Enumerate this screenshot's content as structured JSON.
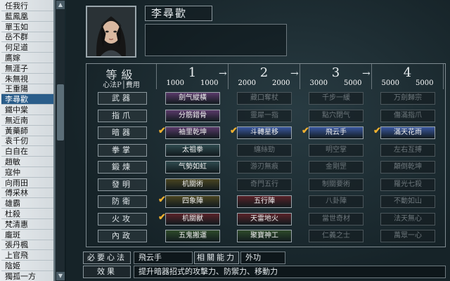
{
  "sidebar": {
    "items": [
      "任我行",
      "藍鳳凰",
      "單玉如",
      "岳不群",
      "何足道",
      "鷹嫁",
      "無涯子",
      "朱無視",
      "王重陽",
      "李尋歡",
      "鐵中棠",
      "無近南",
      "黃藥師",
      "袁千仞",
      "白自在",
      "趙敏",
      "寇仲",
      "向雨田",
      "傅采林",
      "雄霸",
      "杜殺",
      "梵清惠",
      "龐斑",
      "張丹楓",
      "上官飛",
      "陰姬",
      "獨孤一方"
    ],
    "active_index": 9
  },
  "character": {
    "name": "李尋歡"
  },
  "levels": {
    "header_title": "等級",
    "header_sub": "心法P│費用",
    "items": [
      {
        "num": "1",
        "cost_a": "1000",
        "cost_b": "1000"
      },
      {
        "num": "2",
        "cost_a": "2000",
        "cost_b": "2000"
      },
      {
        "num": "3",
        "cost_a": "3000",
        "cost_b": "5000"
      },
      {
        "num": "4",
        "cost_a": "5000",
        "cost_b": "5000"
      }
    ]
  },
  "rows": [
    {
      "label": "武器",
      "cells": [
        {
          "text": "劍气縱橫",
          "style": "purple"
        },
        {
          "text": "藏口奪杖",
          "style": "dim"
        },
        {
          "text": "千步一緩",
          "style": "dim"
        },
        {
          "text": "万劍歸宗",
          "style": "dim"
        }
      ]
    },
    {
      "label": "指爪",
      "cells": [
        {
          "text": "分筋錯骨",
          "style": "purple"
        },
        {
          "text": "靈犀一指",
          "style": "dim"
        },
        {
          "text": "點穴閉气",
          "style": "dim"
        },
        {
          "text": "傷滿指爪",
          "style": "dim"
        }
      ]
    },
    {
      "label": "暗器",
      "cells": [
        {
          "text": "袖里乾坤",
          "style": "purple",
          "check": true
        },
        {
          "text": "斗轉星移",
          "style": "blue",
          "check": true
        },
        {
          "text": "飛云手",
          "style": "blue",
          "check": true
        },
        {
          "text": "滿天花雨",
          "style": "blue",
          "check": true
        }
      ]
    },
    {
      "label": "拳掌",
      "cells": [
        {
          "text": "太祖拳",
          "style": "teal"
        },
        {
          "text": "纏絲勁",
          "style": "dim"
        },
        {
          "text": "明空掌",
          "style": "dim"
        },
        {
          "text": "左右互搏",
          "style": "dim"
        }
      ]
    },
    {
      "label": "鍛煉",
      "cells": [
        {
          "text": "气勢如虹",
          "style": "teal"
        },
        {
          "text": "游刃無痕",
          "style": "dim"
        },
        {
          "text": "金剛罡",
          "style": "dim"
        },
        {
          "text": "顛倒乾坤",
          "style": "dim"
        }
      ]
    },
    {
      "label": "發明",
      "cells": [
        {
          "text": "机關術",
          "style": "olive"
        },
        {
          "text": "奇門五行",
          "style": "dim"
        },
        {
          "text": "制關要術",
          "style": "dim"
        },
        {
          "text": "羅光七殺",
          "style": "dim"
        }
      ]
    },
    {
      "label": "防衛",
      "cells": [
        {
          "text": "四象陣",
          "style": "olive",
          "check": true
        },
        {
          "text": "五行陣",
          "style": "red"
        },
        {
          "text": "八卦陣",
          "style": "dim"
        },
        {
          "text": "不動如山",
          "style": "dim"
        }
      ]
    },
    {
      "label": "火攻",
      "cells": [
        {
          "text": "机關獸",
          "style": "red",
          "check": true
        },
        {
          "text": "天雷地火",
          "style": "red"
        },
        {
          "text": "當世奇材",
          "style": "dim"
        },
        {
          "text": "法天無心",
          "style": "dim"
        }
      ]
    },
    {
      "label": "內政",
      "cells": [
        {
          "text": "五鬼搬運",
          "style": "green"
        },
        {
          "text": "聚寶神工",
          "style": "green"
        },
        {
          "text": "仁義之士",
          "style": "dim"
        },
        {
          "text": "萬眾一心",
          "style": "dim"
        }
      ]
    }
  ],
  "bottom": {
    "req_label": "必要心法",
    "req_value": "飛云手",
    "rel_label": "相關能力",
    "rel_value": "外功",
    "effect_label": "效果",
    "effect_value": "提升暗器招式的攻擊力、防禦力、移動力"
  },
  "colors": {
    "purple": "#5a3a6a",
    "blue": "#3a58a0",
    "teal": "#2f4a4e",
    "olive": "#4a4520",
    "red": "#5a2228",
    "green": "#2e4a2a",
    "check": "#f0b030"
  }
}
